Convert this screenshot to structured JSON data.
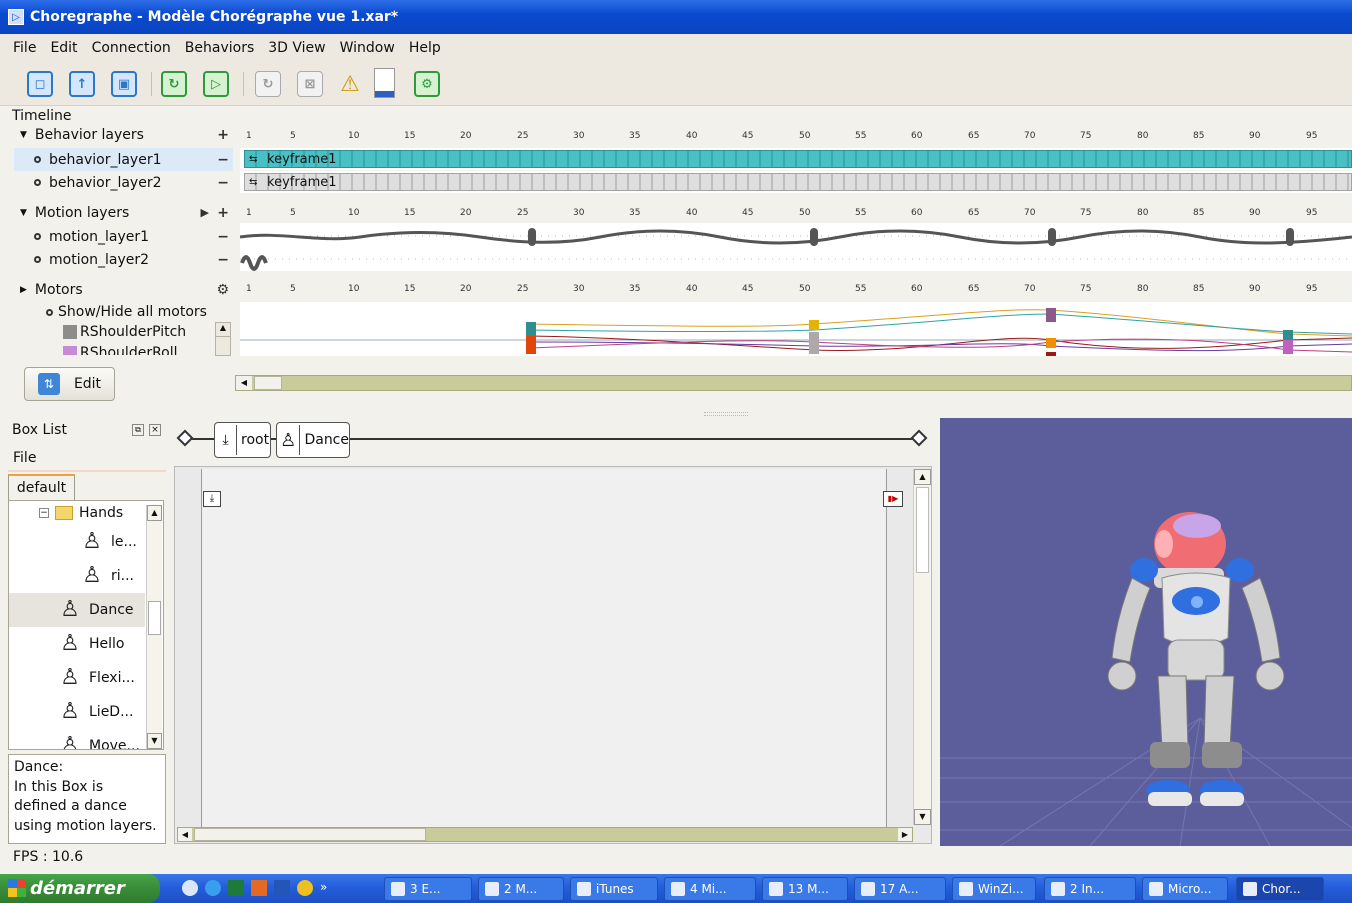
{
  "window": {
    "title": "Choregraphe - Modèle Chorégraphe vue 1.xar*"
  },
  "menu": [
    "File",
    "Edit",
    "Connection",
    "Behaviors",
    "3D View",
    "Window",
    "Help"
  ],
  "timeline": {
    "title": "Timeline",
    "ruler_ticks": [
      "1",
      "5",
      "10",
      "15",
      "20",
      "25",
      "30",
      "35",
      "40",
      "45",
      "50",
      "55",
      "60",
      "65",
      "70",
      "75",
      "80",
      "85",
      "90",
      "95"
    ],
    "behavior_layers": {
      "label": "Behavior layers",
      "add": "+",
      "items": [
        {
          "name": "behavior_layer1",
          "keyframe": "keyframe1",
          "remove": "−"
        },
        {
          "name": "behavior_layer2",
          "keyframe": "keyframe1",
          "remove": "−"
        }
      ]
    },
    "motion_layers": {
      "label": "Motion layers",
      "play": "▶",
      "add": "+",
      "items": [
        {
          "name": "motion_layer1",
          "remove": "−"
        },
        {
          "name": "motion_layer2",
          "remove": "−"
        }
      ]
    },
    "motors": {
      "label": "Motors",
      "show_hide": "Show/Hide all motors",
      "items": [
        "RShoulderPitch",
        "RShoulderRoll"
      ]
    },
    "edit_button": "Edit"
  },
  "box_list": {
    "title": "Box List",
    "file_label": "File",
    "tab": "default",
    "items": [
      {
        "label": "Hands",
        "kind": "folder"
      },
      {
        "label": "le...",
        "kind": "box"
      },
      {
        "label": "ri...",
        "kind": "box"
      },
      {
        "label": "Dance",
        "kind": "box",
        "selected": true
      },
      {
        "label": "Hello",
        "kind": "box"
      },
      {
        "label": "Flexi...",
        "kind": "box"
      },
      {
        "label": "LieD...",
        "kind": "box"
      },
      {
        "label": "Move...",
        "kind": "box"
      }
    ],
    "description": {
      "name": "Dance:",
      "text": "In this Box is defined a dance using motion layers."
    }
  },
  "breadcrumb": [
    "root",
    "Dance"
  ],
  "status": {
    "fps": "FPS : 10.6"
  },
  "taskbar": {
    "start": "démarrer",
    "tasks": [
      "3 E...",
      "2 M...",
      "iTunes",
      "4 Mi...",
      "13 M...",
      "17 A...",
      "WinZi...",
      "2 In...",
      "Micro...",
      "Chor..."
    ]
  },
  "colors": {
    "titlebar": "#0b44c2",
    "keyframe_active": "#49c0c4",
    "viewport": "#5c5e9b",
    "start_button": "#3a8e3a"
  }
}
